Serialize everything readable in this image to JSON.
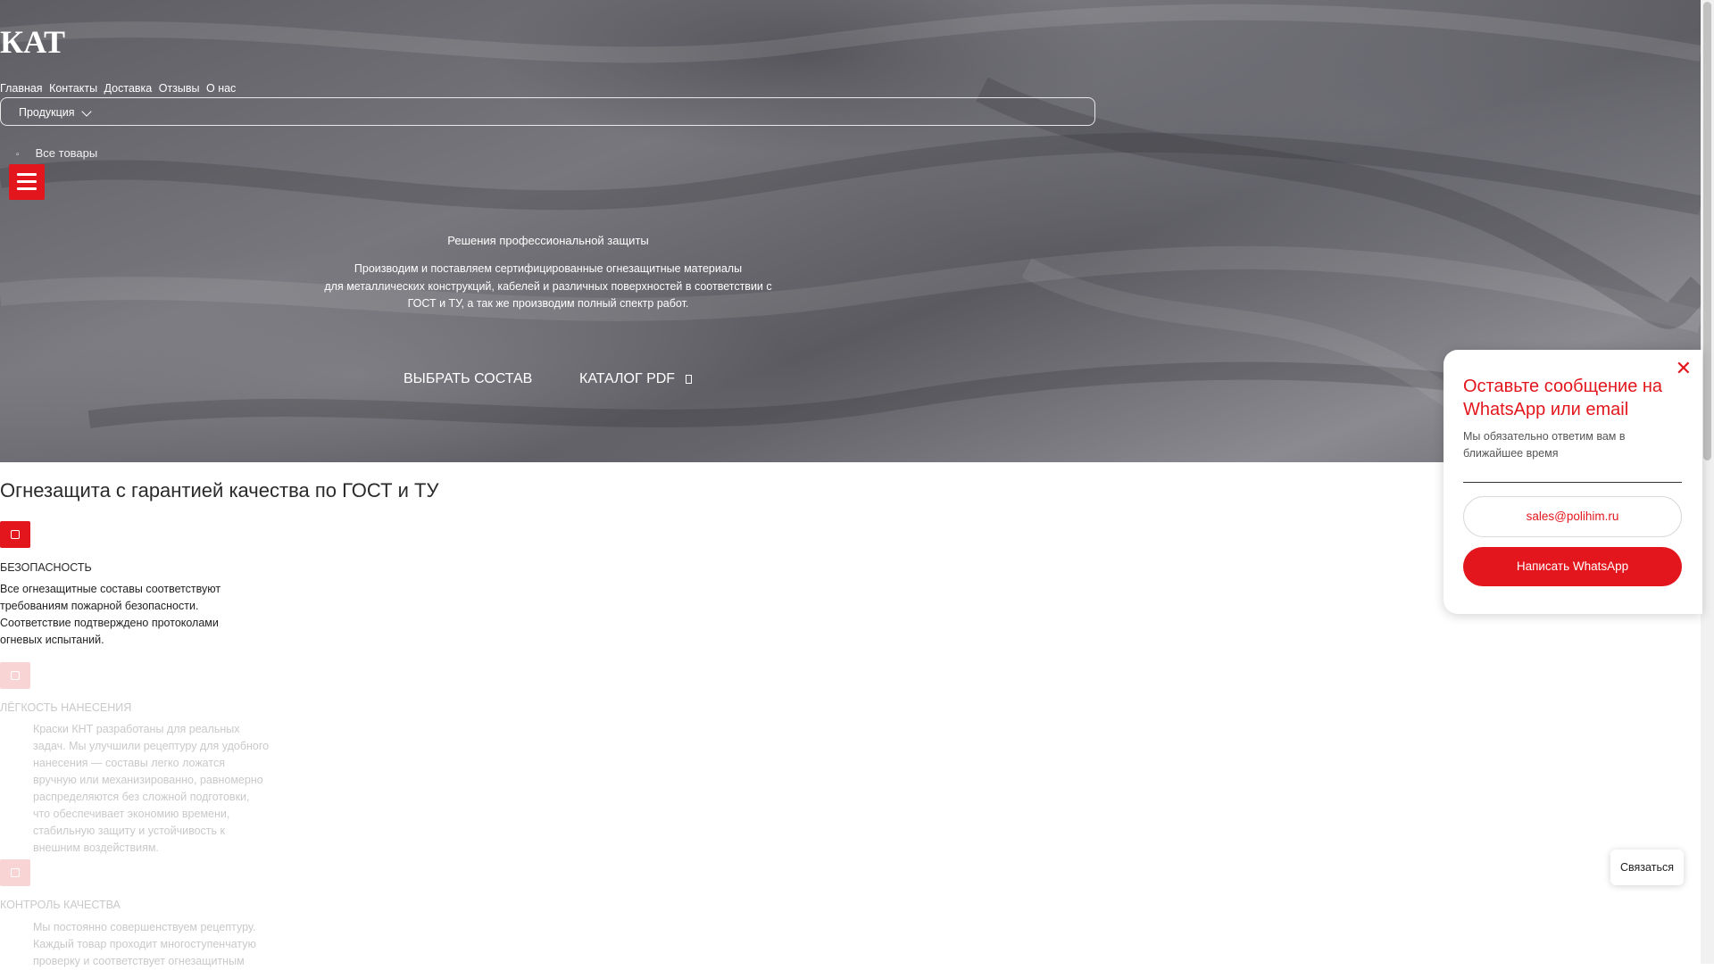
{
  "colors": {
    "accent": "#e2161c",
    "hero_bg": "#6a6a70"
  },
  "logo": {
    "text": "КАТ"
  },
  "nav": {
    "items": [
      "Главная",
      "Контакты",
      "Доставка",
      "Отзывы",
      "О нас"
    ]
  },
  "products_menu": {
    "label": "Продукция"
  },
  "all_goods": {
    "label": "Все товары"
  },
  "hero": {
    "subtitle": "Решения профессиональной защиты",
    "description_lines": [
      "Производим и поставляем сертифицированные огнезащитные материалы",
      "для металлических конструкций, кабелей и различных поверхностей в соответствии с",
      "ГОСТ и ТУ, а так же производим полный спектр работ."
    ],
    "btn_choose": "ВЫБРАТЬ СОСТАВ",
    "btn_catalog": "КАТАЛОГ PDF"
  },
  "section": {
    "title": "Огнезащита с гарантией качества по ГОСТ и ТУ"
  },
  "features": [
    {
      "title": "БЕЗОПАСНОСТЬ",
      "lines": [
        "Все огнезащитные составы соответствуют",
        "требованиям пожарной безопасности.",
        "Соответствие подтверждено протоколами",
        "огневых испытаний."
      ]
    },
    {
      "title": "ЛЁГКОСТЬ НАНЕСЕНИЯ",
      "lines": [
        "Краски КНТ разработаны для реальных",
        "задач. Мы улучшили рецептуру для удобного",
        "нанесения — составы легко ложатся",
        "вручную или механизированно, равномерно",
        "распределяются без сложной подготовки,",
        "что обеспечивает экономию времени,",
        "стабильную защиту и устойчивость к",
        "внешним воздействиям."
      ]
    },
    {
      "title": "КОНТРОЛЬ КАЧЕСТВА",
      "lines": [
        "Мы постоянно совершенствуем рецептуру.",
        "Каждый товар проходит многоступенчатую",
        "проверку и соответствует огнезащитным"
      ]
    }
  ],
  "popup": {
    "title": "Оставьте сообщение на WhatsApp или email",
    "subtitle": "Мы обязательно ответим вам в ближайшее время",
    "email": "sales@polihim.ru",
    "whatsapp_label": "Написать WhatsApp",
    "close_icon": "close-icon"
  },
  "contact_button": {
    "label": "Связаться"
  }
}
